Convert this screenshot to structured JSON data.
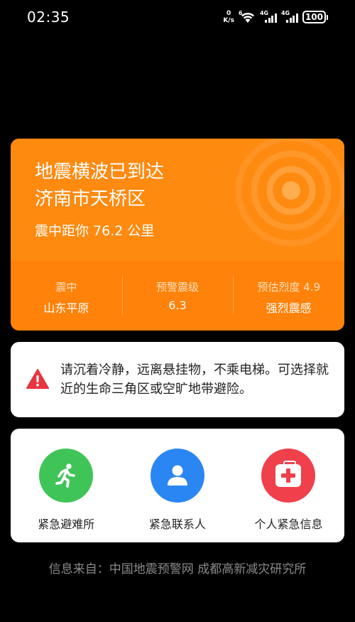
{
  "status_bar": {
    "time": "02:35",
    "net_speed_value": "0",
    "net_speed_unit": "K/s",
    "wifi_label": "6",
    "sim1_label": "4G",
    "sim2_label": "4G",
    "battery": "100"
  },
  "alert": {
    "title_line1": "地震横波已到达",
    "title_line2": "济南市天桥区",
    "distance": "震中距你 76.2 公里",
    "stats": [
      {
        "label": "震中",
        "value": "山东平原"
      },
      {
        "label": "预警震级",
        "value": "6.3"
      },
      {
        "label": "预估烈度 4.9",
        "value": "强烈震感"
      }
    ],
    "colors": {
      "primary": "#ff8a10",
      "secondary": "#ff820a"
    }
  },
  "advice": {
    "icon": "warning-triangle-icon",
    "text": "请沉着冷静，远离悬挂物，不乘电梯。可选择就近的生命三角区或空旷地带避险。"
  },
  "actions": [
    {
      "label": "紧急避难所",
      "icon": "running-person-icon",
      "color": "#3fc457"
    },
    {
      "label": "紧急联系人",
      "icon": "person-icon",
      "color": "#2a86f2"
    },
    {
      "label": "个人紧急信息",
      "icon": "medkit-icon",
      "color": "#f0404b"
    }
  ],
  "footer": {
    "source": "信息来自：中国地震预警网 成都高新减灾研究所"
  }
}
